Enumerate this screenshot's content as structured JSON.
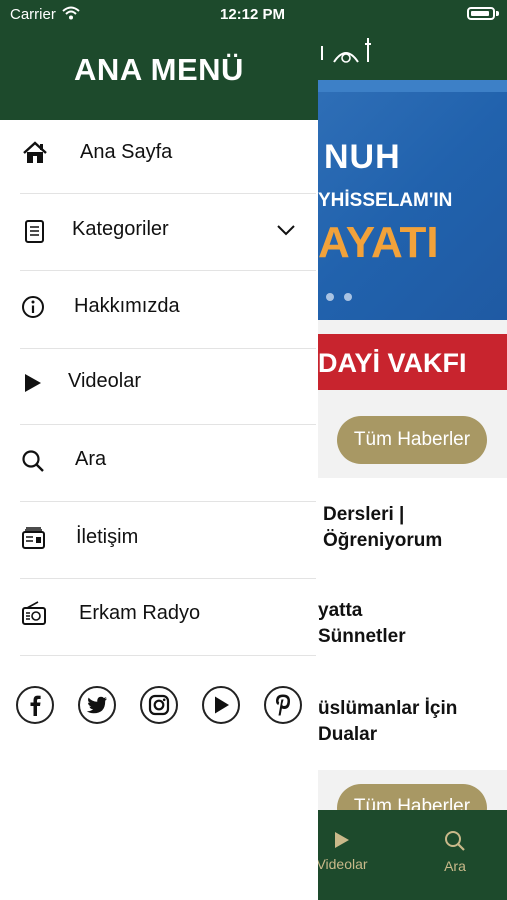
{
  "status_bar": {
    "carrier": "Carrier",
    "time": "12:12 PM"
  },
  "drawer": {
    "title": "ANA MENÜ",
    "items": [
      {
        "label": "Ana Sayfa",
        "icon": "home-icon"
      },
      {
        "label": "Kategoriler",
        "icon": "document-icon",
        "expandable": true
      },
      {
        "label": "Hakkımızda",
        "icon": "info-icon"
      },
      {
        "label": "Videolar",
        "icon": "play-icon"
      },
      {
        "label": "Ara",
        "icon": "search-icon"
      },
      {
        "label": "İletişim",
        "icon": "contact-card-icon"
      },
      {
        "label": "Erkam Radyo",
        "icon": "radio-icon"
      }
    ],
    "social": [
      "facebook-icon",
      "twitter-icon",
      "instagram-icon",
      "youtube-icon",
      "pinterest-icon"
    ]
  },
  "background": {
    "banner": {
      "line1": "NUH",
      "line2": "YHİSSELAM'IN",
      "line3": "AYATI"
    },
    "red_bar": "DAYİ VAKFI",
    "all_news_label": "Tüm Haberler",
    "news": [
      "Dersleri |\nÖğreniyorum",
      "yatta\nSünnetler",
      "üslümanlar İçin\nDualar"
    ],
    "all_news_label_2": "Tüm Haberler",
    "tabs": [
      {
        "label": "Videolar",
        "icon": "play-icon"
      },
      {
        "label": "Ara",
        "icon": "search-icon"
      }
    ]
  },
  "colors": {
    "brand_green": "#1d4a2c",
    "accent_gold": "#a89864",
    "red": "#c8242e",
    "banner_blue": "#2162ad"
  }
}
